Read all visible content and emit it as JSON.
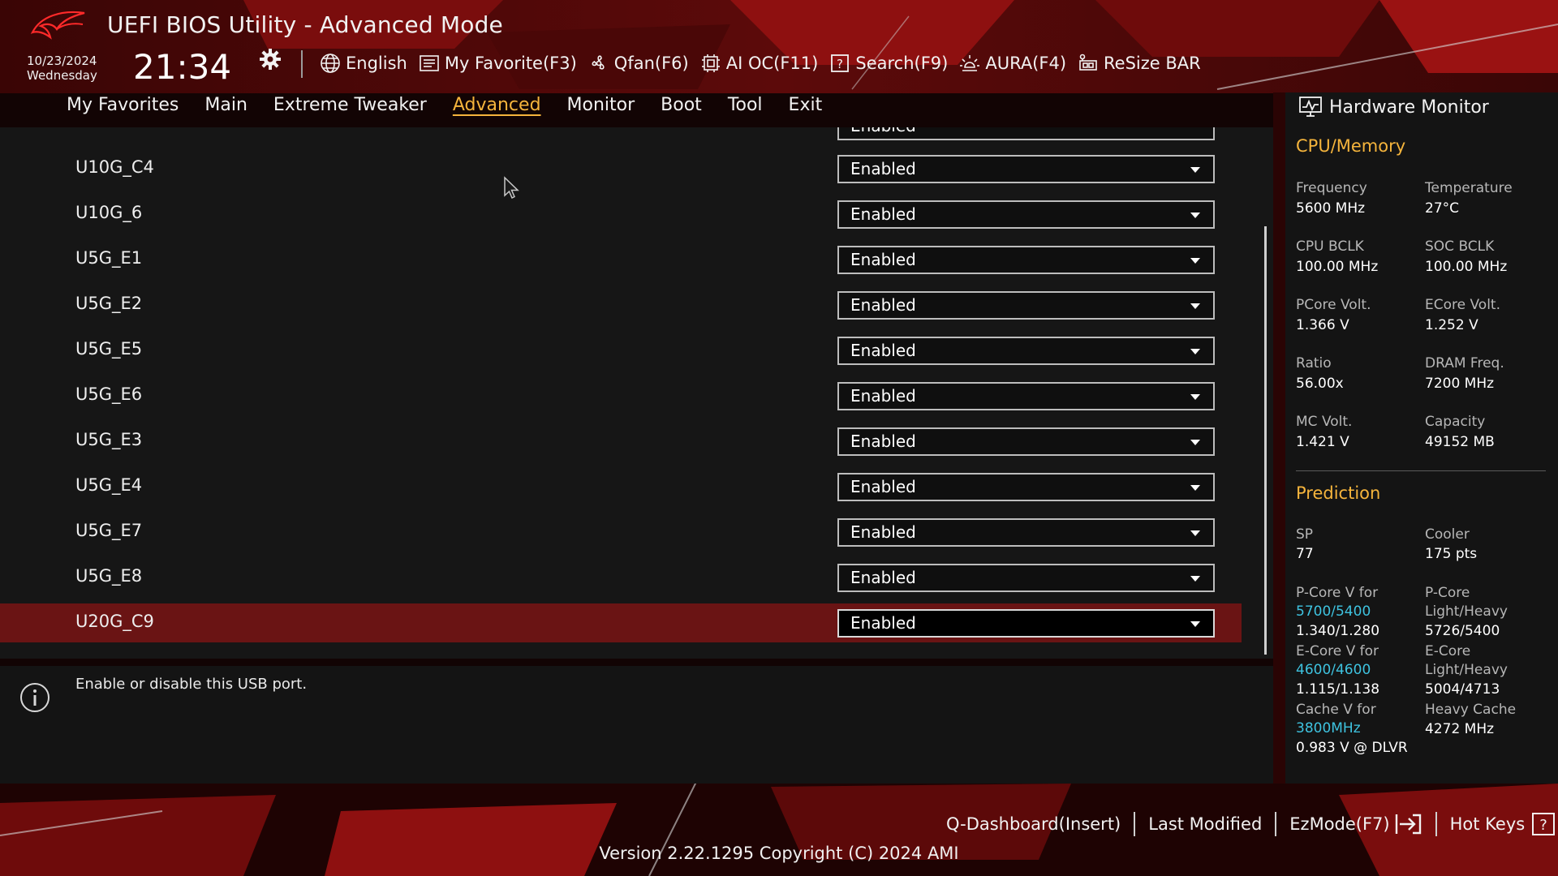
{
  "header": {
    "title": "UEFI BIOS Utility - Advanced Mode",
    "date": "10/23/2024",
    "weekday": "Wednesday",
    "time": "21:34"
  },
  "toolbar": [
    {
      "icon": "globe-icon",
      "label": "English"
    },
    {
      "icon": "my-favorite-icon",
      "label": "My Favorite(F3)"
    },
    {
      "icon": "fan-icon",
      "label": "Qfan(F6)"
    },
    {
      "icon": "ai-oc-icon",
      "label": "AI OC(F11)"
    },
    {
      "icon": "search-icon",
      "label": "Search(F9)"
    },
    {
      "icon": "aura-icon",
      "label": "AURA(F4)"
    },
    {
      "icon": "resize-bar-icon",
      "label": "ReSize BAR"
    }
  ],
  "tabs": [
    "My Favorites",
    "Main",
    "Extreme Tweaker",
    "Advanced",
    "Monitor",
    "Boot",
    "Tool",
    "Exit"
  ],
  "active_tab": "Advanced",
  "settings": {
    "partial_row_value": "Enabled",
    "rows": [
      {
        "label": "U10G_C4",
        "value": "Enabled"
      },
      {
        "label": "U10G_6",
        "value": "Enabled"
      },
      {
        "label": "U5G_E1",
        "value": "Enabled"
      },
      {
        "label": "U5G_E2",
        "value": "Enabled"
      },
      {
        "label": "U5G_E5",
        "value": "Enabled"
      },
      {
        "label": "U5G_E6",
        "value": "Enabled"
      },
      {
        "label": "U5G_E3",
        "value": "Enabled"
      },
      {
        "label": "U5G_E4",
        "value": "Enabled"
      },
      {
        "label": "U5G_E7",
        "value": "Enabled"
      },
      {
        "label": "U5G_E8",
        "value": "Enabled"
      },
      {
        "label": "U20G_C9",
        "value": "Enabled"
      }
    ],
    "selected_index": 10
  },
  "help": {
    "text": "Enable or disable this USB port."
  },
  "hw_monitor": {
    "title": "Hardware Monitor",
    "cpu_memory_title": "CPU/Memory",
    "cpu_memory": [
      {
        "label": "Frequency",
        "value": "5600 MHz"
      },
      {
        "label": "Temperature",
        "value": "27°C"
      },
      {
        "label": "CPU BCLK",
        "value": "100.00 MHz"
      },
      {
        "label": "SOC BCLK",
        "value": "100.00 MHz"
      },
      {
        "label": "PCore Volt.",
        "value": "1.366 V"
      },
      {
        "label": "ECore Volt.",
        "value": "1.252 V"
      },
      {
        "label": "Ratio",
        "value": "56.00x"
      },
      {
        "label": "DRAM Freq.",
        "value": "7200 MHz"
      },
      {
        "label": "MC Volt.",
        "value": "1.421 V"
      },
      {
        "label": "Capacity",
        "value": "49152 MB"
      }
    ],
    "prediction_title": "Prediction",
    "sp": {
      "label": "SP",
      "value": "77"
    },
    "cooler": {
      "label": "Cooler",
      "value": "175 pts"
    },
    "pcore_v": {
      "label": "P-Core V for",
      "hl": "5700/5400",
      "value": "1.340/1.280"
    },
    "pcore_lh": {
      "label1": "P-Core",
      "label2": "Light/Heavy",
      "value": "5726/5400"
    },
    "ecore_v": {
      "label": "E-Core V for",
      "hl": "4600/4600",
      "value": "1.115/1.138"
    },
    "ecore_lh": {
      "label1": "E-Core",
      "label2": "Light/Heavy",
      "value": "5004/4713"
    },
    "cache_v": {
      "label": "Cache V for",
      "hl": "3800MHz",
      "value": "0.983 V @ DLVR"
    },
    "heavy_cache": {
      "label": "Heavy Cache",
      "value": "4272 MHz"
    }
  },
  "bottom": {
    "qdashboard": "Q-Dashboard(Insert)",
    "last_modified": "Last Modified",
    "ezmode": "EzMode(F7)",
    "hotkeys": "Hot Keys",
    "hotkeys_icon_text": "?",
    "version": "Version 2.22.1295 Copyright (C) 2024 AMI"
  },
  "colors": {
    "accent": "#f5b43c",
    "highlight_blue": "#3ec3e0",
    "selected_row": "#6a1414",
    "brand_red": "#b01010"
  }
}
